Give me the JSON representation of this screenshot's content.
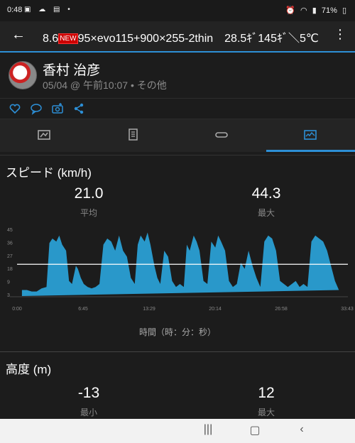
{
  "status_bar": {
    "time": "0:48",
    "battery": "71%"
  },
  "header": {
    "title_prefix": "8.6",
    "title_new": "NEW",
    "title_rest": "95×evo115+900×255-2thin　28.5ｷﾞ145ｷﾞ＼5℃"
  },
  "profile": {
    "name": "香村 治彦",
    "meta": "05/04 @ 午前10:07 • その他"
  },
  "speed": {
    "title": "スピード (km/h)",
    "avg_value": "21.0",
    "avg_label": "平均",
    "max_value": "44.3",
    "max_label": "最大",
    "x_axis_title": "時間（時：分：秒）"
  },
  "altitude": {
    "title": "高度 (m)",
    "min_value": "-13",
    "min_label": "最小",
    "max_value": "12",
    "max_label": "最大"
  },
  "chart_data": {
    "type": "area",
    "title": "スピード (km/h)",
    "xlabel": "時間（時：分：秒）",
    "ylabel": "",
    "x_ticks": [
      "0:00",
      "6:45",
      "13:29",
      "20:14",
      "26:58",
      "33:43"
    ],
    "y_ticks": [
      "3",
      "9",
      "18",
      "27",
      "36",
      "45"
    ],
    "ylim": [
      0,
      46
    ],
    "xlim": [
      0,
      33.72
    ],
    "avg_line": 21.0,
    "color": "#2ba6de",
    "x": [
      0.5,
      1,
      1.5,
      2,
      2.5,
      3,
      3.3,
      3.6,
      4,
      4.3,
      4.6,
      5,
      5.3,
      5.6,
      6,
      6.2,
      6.5,
      6.8,
      7.2,
      7.6,
      8,
      8.4,
      8.8,
      9.2,
      9.6,
      10,
      10.4,
      10.8,
      11.2,
      11.6,
      12,
      12.3,
      12.6,
      13,
      13.3,
      13.6,
      14,
      14.3,
      14.6,
      15,
      15.4,
      15.8,
      16.2,
      16.6,
      17,
      17.3,
      17.6,
      18,
      18.3,
      18.6,
      19,
      19.4,
      19.8,
      20.2,
      20.5,
      20.8,
      21.2,
      21.6,
      22,
      22.4,
      22.8,
      23.2,
      23.6,
      24,
      24.4,
      24.8,
      25.2,
      25.6,
      26,
      26.4,
      26.8,
      27.2,
      27.6,
      28,
      28.4,
      28.8,
      29.2,
      29.6,
      30,
      30.4,
      30.8,
      31.2,
      31.6,
      32,
      32.4,
      32.8,
      33.2
    ],
    "y": [
      4,
      4,
      3,
      3,
      5,
      6,
      35,
      38,
      36,
      40,
      34,
      30,
      10,
      8,
      20,
      18,
      12,
      8,
      6,
      5,
      6,
      8,
      34,
      38,
      36,
      30,
      40,
      30,
      26,
      12,
      8,
      34,
      40,
      36,
      42,
      34,
      20,
      12,
      8,
      30,
      26,
      10,
      6,
      8,
      6,
      34,
      30,
      40,
      36,
      30,
      10,
      8,
      36,
      32,
      40,
      36,
      30,
      10,
      6,
      8,
      22,
      18,
      30,
      20,
      12,
      6,
      36,
      40,
      38,
      30,
      10,
      8,
      6,
      8,
      10,
      6,
      8,
      6,
      36,
      40,
      38,
      36,
      30,
      20,
      10,
      4
    ]
  }
}
